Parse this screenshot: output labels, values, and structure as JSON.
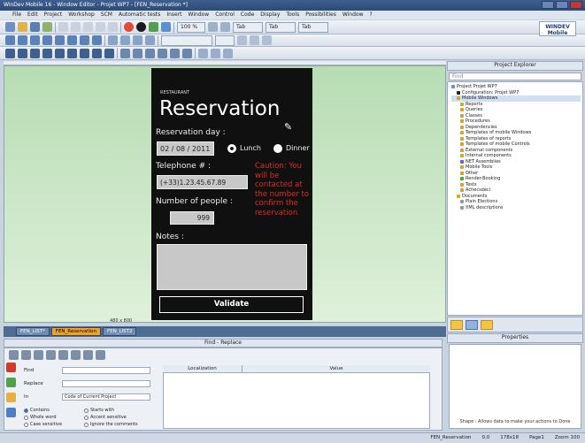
{
  "window": {
    "title": "WinDev Mobile 16 - Window Editor - Projet WP7 - [FEN_Reservation *]"
  },
  "menu": [
    "File",
    "Edit",
    "Project",
    "Workshop",
    "SCM",
    "Automatic tests",
    "Insert",
    "Window",
    "Control",
    "Code",
    "Display",
    "Tools",
    "Possibilities",
    "Window",
    "?"
  ],
  "toolbar": {
    "zoom": "100 %",
    "btn_a": "Tab",
    "btn_b": "Tab",
    "btn_c": "Tab"
  },
  "logo": "WINDEV Mobile",
  "phone": {
    "app_title": "RESTAURANT",
    "heading": "Reservation",
    "day_label": "Reservation day :",
    "day_value": "02 / 08 / 2011",
    "opt_lunch": "Lunch",
    "opt_dinner": "Dinner",
    "phone_label": "Telephone # :",
    "phone_value": "(+33)1.23.45.67.89",
    "caution": "Caution: You will be contacted at the number to confirm the reservation",
    "people_label": "Number of people :",
    "people_value": "999",
    "notes_label": "Notes :",
    "validate": "Validate"
  },
  "size_label": "480 x 800",
  "doc_tabs": [
    {
      "label": "FEN_LIST*"
    },
    {
      "label": "FEN_Reservation"
    },
    {
      "label": "FEN_LIST2"
    }
  ],
  "find": {
    "title": "Find - Replace",
    "find_label": "Find",
    "replace_label": "Replace",
    "in_label": "In",
    "in_value": "Code of Current Project",
    "options": [
      "Contains",
      "Whole word",
      "Case sensitive",
      "Starts with",
      "Accent sensitive",
      "Ignore the comments"
    ],
    "col_location": "Localization",
    "col_value": "Value"
  },
  "project": {
    "title": "Project Explorer",
    "search_placeholder": "Find",
    "items": [
      "Project Projet WP7",
      "Configuration: Projet WP7",
      "Mobile Windows",
      "Reports",
      "Queries",
      "Classes",
      "Procedures",
      "Dependencies",
      "Templates of mobile Windows",
      "Templates of reports",
      "Templates of mobile Controls",
      "External components",
      "Internal components",
      "NET Assemblies",
      "Mobile Tools",
      "Other",
      "Render-Booking",
      "Tests",
      "Achecsdéci",
      "Documents",
      "Plain Elections",
      "XML descriptions"
    ]
  },
  "properties": {
    "title": "Properties",
    "hint": "Shape : Allows data to make your actions to Done"
  },
  "status": {
    "window": "FEN_Reservation",
    "pos": "0,0",
    "size": "178x18",
    "page": "Page1",
    "zoom": "Zoom 100"
  }
}
